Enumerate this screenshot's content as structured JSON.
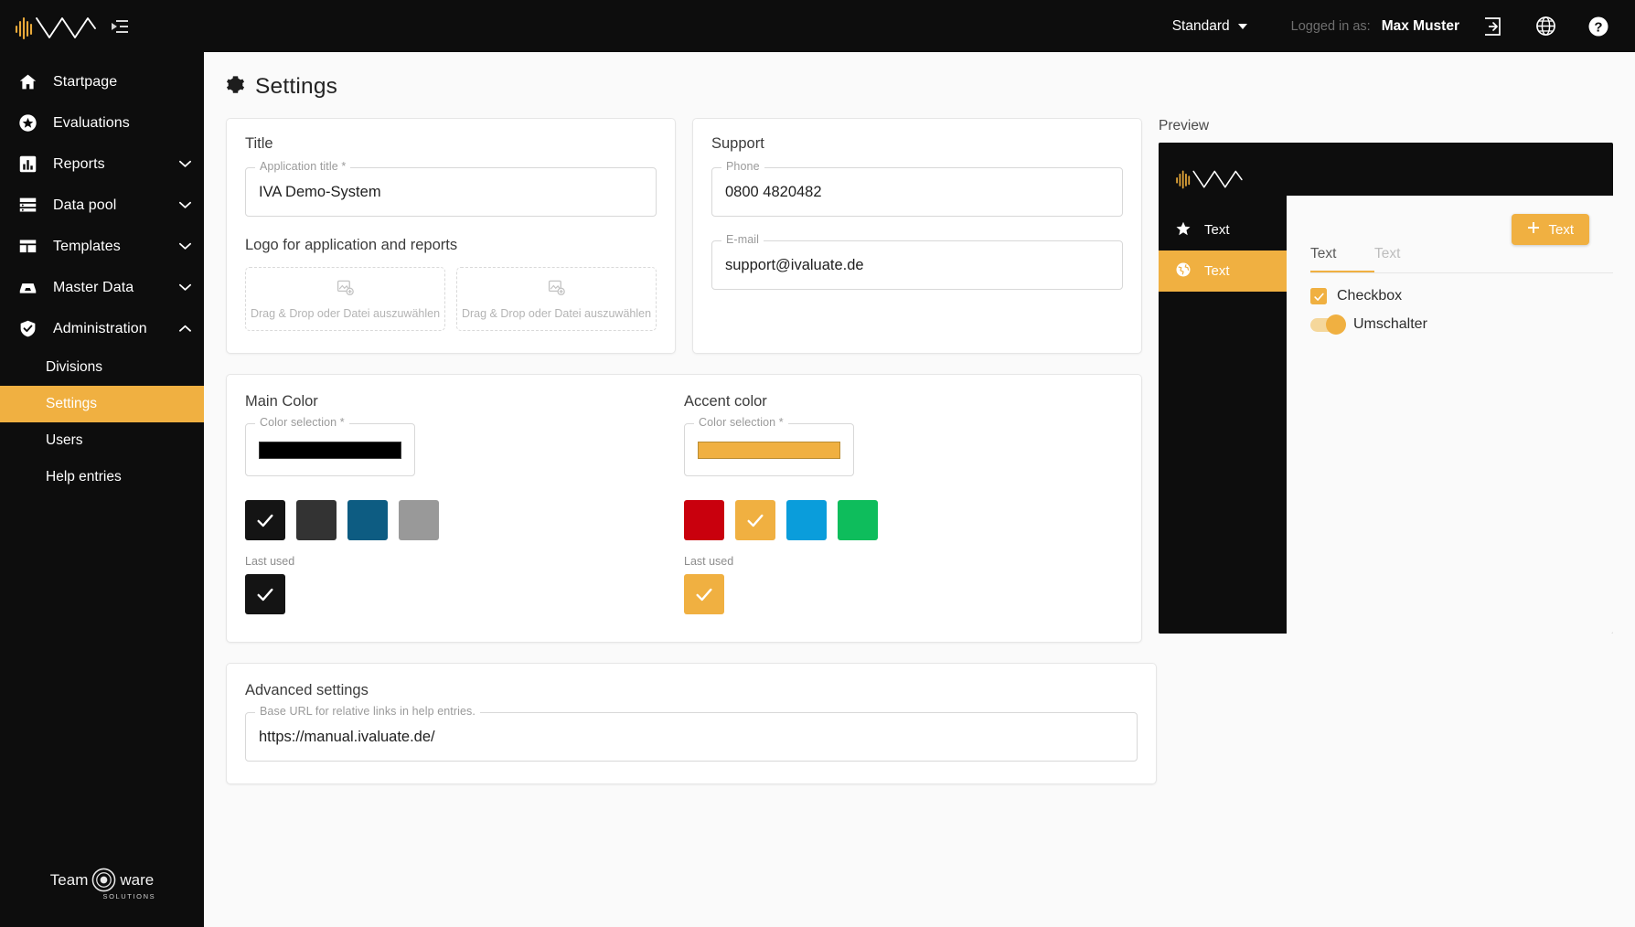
{
  "topbar": {
    "logo_name": "iva-logo",
    "collapse_icon": "collapse-sidebar-icon",
    "profile_select": "Standard",
    "logged_in_label": "Logged in as:",
    "user_name": "Max Muster",
    "icons": [
      "logout-icon",
      "globe-icon",
      "help-icon"
    ]
  },
  "sidebar": {
    "items": [
      {
        "label": "Startpage",
        "icon": "home-icon",
        "expandable": false
      },
      {
        "label": "Evaluations",
        "icon": "star-circle-icon",
        "expandable": false
      },
      {
        "label": "Reports",
        "icon": "bar-chart-icon",
        "expandable": true,
        "expanded": false
      },
      {
        "label": "Data pool",
        "icon": "database-icon",
        "expandable": true,
        "expanded": false
      },
      {
        "label": "Templates",
        "icon": "layout-icon",
        "expandable": true,
        "expanded": false
      },
      {
        "label": "Master Data",
        "icon": "inbox-icon",
        "expandable": true,
        "expanded": false
      },
      {
        "label": "Administration",
        "icon": "shield-check-icon",
        "expandable": true,
        "expanded": true
      }
    ],
    "sub_items": [
      {
        "label": "Divisions",
        "active": false
      },
      {
        "label": "Settings",
        "active": true
      },
      {
        "label": "Users",
        "active": false
      },
      {
        "label": "Help entries",
        "active": false
      }
    ],
    "footer_logo": {
      "part1": "Team",
      "part2": "ware",
      "tagline": "SOLUTIONS"
    }
  },
  "page": {
    "title": "Settings",
    "title_icon": "gear-icon"
  },
  "title_card": {
    "heading": "Title",
    "app_title_legend": "Application title *",
    "app_title_value": "IVA Demo-System",
    "logo_heading": "Logo for application and reports",
    "dropzones": [
      {
        "text": "Drag & Drop oder Datei auszuwählen",
        "icon": "image-add-icon"
      },
      {
        "text": "Drag & Drop oder Datei auszuwählen",
        "icon": "image-add-icon"
      }
    ]
  },
  "support_card": {
    "heading": "Support",
    "phone_legend": "Phone",
    "phone_value": "0800 4820482",
    "email_legend": "E-mail",
    "email_value": "support@ivaluate.de"
  },
  "main_color": {
    "heading": "Main Color",
    "legend": "Color selection *",
    "value": "#000000",
    "swatches": [
      {
        "color": "#141414",
        "selected": true
      },
      {
        "color": "#333333",
        "selected": false
      },
      {
        "color": "#0d5c82",
        "selected": false
      },
      {
        "color": "#999999",
        "selected": false
      }
    ],
    "last_used_label": "Last used",
    "last_used": [
      {
        "color": "#141414",
        "selected": true
      }
    ]
  },
  "accent_color": {
    "heading": "Accent color",
    "legend": "Color selection *",
    "value": "#F0B041",
    "swatches": [
      {
        "color": "#c9000d",
        "selected": false
      },
      {
        "color": "#f0b041",
        "selected": true
      },
      {
        "color": "#0a9ddb",
        "selected": false
      },
      {
        "color": "#0ebd5c",
        "selected": false
      }
    ],
    "last_used_label": "Last used",
    "last_used": [
      {
        "color": "#f0b041",
        "selected": true
      }
    ]
  },
  "advanced": {
    "heading": "Advanced settings",
    "url_legend": "Base URL for relative links in help entries.",
    "url_value": "https://manual.ivaluate.de/"
  },
  "preview": {
    "label": "Preview",
    "nav_items": [
      {
        "label": "Text",
        "icon": "star-icon",
        "active": false
      },
      {
        "label": "Text",
        "icon": "globe-icon",
        "active": true
      }
    ],
    "add_button": "Text",
    "add_button_icon": "plus-icon",
    "tabs": [
      {
        "label": "Text",
        "active": true
      },
      {
        "label": "Text",
        "active": false
      }
    ],
    "checkbox_label": "Checkbox",
    "toggle_label": "Umschalter"
  },
  "colors": {
    "accent": "#F0B041",
    "sidebar_bg": "#0D0D0D",
    "page_bg": "#FAFAFA"
  }
}
